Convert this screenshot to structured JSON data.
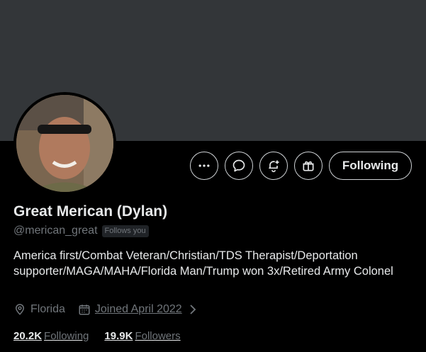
{
  "profile": {
    "display_name": "Great Merican (Dylan)",
    "handle": "@merican_great",
    "follows_you_badge": "Follows you",
    "bio": "America first/Combat Veteran/Christian/TDS Therapist/Deportation supporter/MAGA/MAHA/Florida Man/Trump won 3x/Retired Army Colonel",
    "location": "Florida",
    "joined": "Joined April 2022",
    "following_count": "20.2K",
    "following_label": "Following",
    "followers_count": "19.9K",
    "followers_label": "Followers"
  },
  "actions": {
    "follow_button_label": "Following"
  },
  "icons": {
    "more": "more-icon",
    "message": "message-icon",
    "notify": "bell-plus-icon",
    "gift": "gift-icon",
    "location": "location-pin-icon",
    "calendar": "calendar-icon"
  },
  "colors": {
    "background": "#000000",
    "banner": "#333639",
    "text_primary": "#e7e9ea",
    "text_secondary": "#71767b"
  }
}
